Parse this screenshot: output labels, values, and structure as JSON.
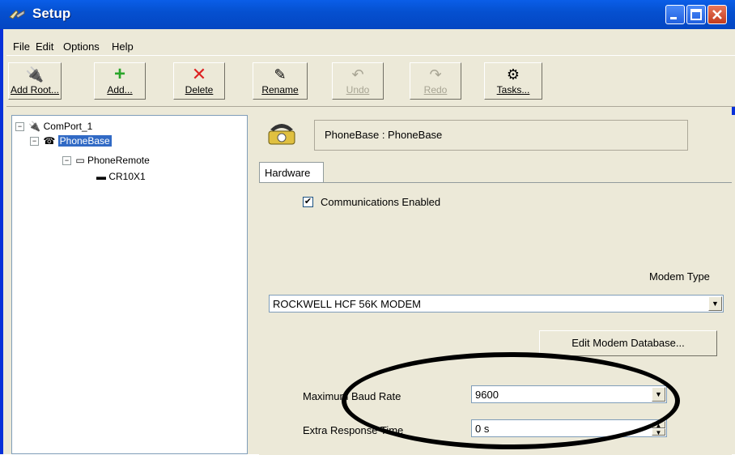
{
  "window": {
    "title": "Setup"
  },
  "menu": {
    "file": "File",
    "edit": "Edit",
    "options": "Options",
    "help": "Help"
  },
  "toolbar": {
    "add_root": "Add Root...",
    "add": "Add...",
    "delete": "Delete",
    "rename": "Rename",
    "undo": "Undo",
    "redo": "Redo",
    "tasks": "Tasks..."
  },
  "tree": {
    "root": "ComPort_1",
    "child": "PhoneBase",
    "grandchild": "PhoneRemote",
    "leaf": "CR10X1"
  },
  "panel": {
    "header": "PhoneBase : PhoneBase",
    "tab": "Hardware",
    "comm_enabled_label": "Communications Enabled",
    "comm_enabled_checked": true,
    "modem_type_label": "Modem Type",
    "modem_type_value": "ROCKWELL HCF 56K MODEM",
    "edit_modem_db": "Edit Modem Database...",
    "max_baud_label": "Maximum Baud Rate",
    "max_baud_value": "9600",
    "extra_response_label": "Extra Response Time",
    "extra_response_value": "0 s"
  }
}
